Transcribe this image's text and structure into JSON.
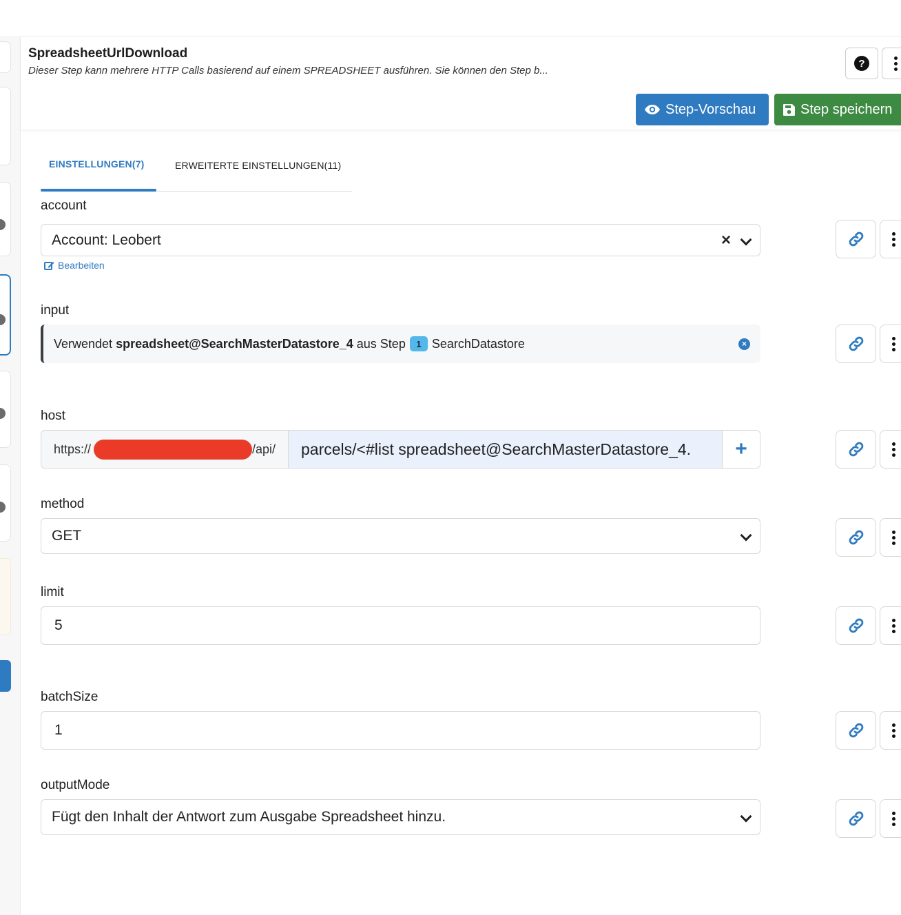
{
  "header": {
    "title": "SpreadsheetUrlDownload",
    "description": "Dieser Step kann mehrere HTTP Calls basierend auf einem SPREADSHEET ausführen. Sie können den Step b...",
    "help_icon": "?",
    "preview_label": "Step-Vorschau",
    "save_label": "Step speichern"
  },
  "tabs": [
    {
      "label": "EINSTELLUNGEN(7)",
      "active": true
    },
    {
      "label": "ERWEITERTE EINSTELLUNGEN(11)",
      "active": false
    }
  ],
  "fields": {
    "account": {
      "label": "account",
      "value": "Account: Leobert",
      "edit_label": "Bearbeiten"
    },
    "input": {
      "label": "input",
      "prefix": "Verwendet ",
      "variable": "spreadsheet@SearchMasterDatastore_4",
      "middle": " aus Step",
      "step_number": "1",
      "step_name": "SearchDatastore"
    },
    "host": {
      "label": "host",
      "prefix_start": "https://",
      "prefix_end": "/api/",
      "path": "parcels/<#list spreadsheet@SearchMasterDatastore_4.",
      "add_symbol": "+"
    },
    "method": {
      "label": "method",
      "value": "GET"
    },
    "limit": {
      "label": "limit",
      "value": "5"
    },
    "batchSize": {
      "label": "batchSize",
      "value": "1"
    },
    "outputMode": {
      "label": "outputMode",
      "value": "Fügt den Inhalt der Antwort zum Ausgabe Spreadsheet hinzu."
    }
  },
  "colors": {
    "primary": "#2f7bc1",
    "success": "#3d8a43",
    "badge": "#55b7e9",
    "redaction": "#e93b28"
  },
  "icons": [
    "question-circle-icon",
    "more-vertical-icon",
    "eye-icon",
    "save-icon",
    "edit-icon",
    "clear-icon",
    "chevron-down-icon",
    "close-circle-icon",
    "plus-icon",
    "link-icon"
  ]
}
